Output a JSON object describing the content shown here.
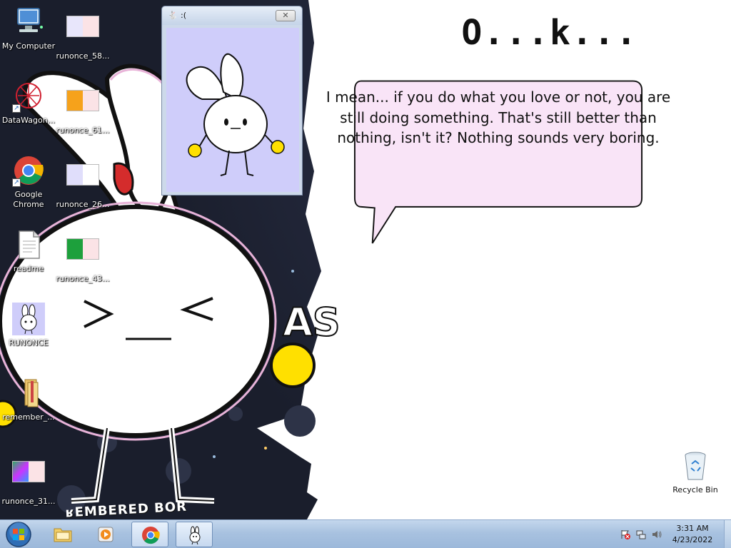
{
  "desktop": {
    "icons": [
      {
        "label": "My Computer"
      },
      {
        "label": "runonce_58..."
      },
      {
        "label": "DataWagon..."
      },
      {
        "label": "runonce_61..."
      },
      {
        "label": "Google Chrome"
      },
      {
        "label": "runonce_26..."
      },
      {
        "label": "readme"
      },
      {
        "label": "runonce_43..."
      },
      {
        "label": "RUNONCE"
      },
      {
        "label": "remember_..."
      },
      {
        "label": "runonce_31..."
      },
      {
        "label": "Recycle Bin"
      }
    ],
    "wallpaper_text": "ʁEMBERED BOR"
  },
  "small_window": {
    "title": ":(",
    "close_glyph": "✕",
    "background": "#cfcdfa"
  },
  "dialog": {
    "heading": "O...k...",
    "message": "I mean... if you do what you love or not, you are still doing something. That's still better than nothing, isn't it? Nothing sounds very boring.",
    "bubble_color": "#f9e4f7"
  },
  "taskbar": {
    "items": [
      "start-button",
      "explorer",
      "media-player",
      "google-chrome",
      "runonce"
    ],
    "clock_time": "3:31 AM",
    "clock_date": "4/23/2022"
  }
}
